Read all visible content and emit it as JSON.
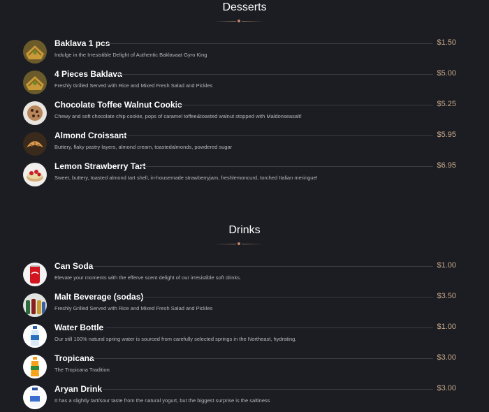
{
  "desserts": {
    "title": "Desserts",
    "items": [
      {
        "name": "Baklava 1 pcs",
        "description": "Indulge in the Irresistible Delight of Authentic Baklavaat Gyro King",
        "price": "$1.50",
        "icon": "baklava-icon"
      },
      {
        "name": "4 Pieces Baklava",
        "description": "Freshly Grilled Served with Rice and Mixed Fresh Salad and Pickles",
        "price": "$5.00",
        "icon": "baklava-icon"
      },
      {
        "name": "Chocolate Toffee Walnut Cookie",
        "description": "Chewy and soft chocolate chip cookie, pops of caramel toffee&toasted walnut stopped with Maldonseasalt!",
        "price": "$5.25",
        "icon": "cookie-icon"
      },
      {
        "name": "Almond Croissant",
        "description": "Buttery, flaky pastry layers, almond cream, toastedalmonds, powdered sugar",
        "price": "$5.95",
        "icon": "croissant-icon"
      },
      {
        "name": "Lemon Strawberry Tart",
        "description": "Sweet, buttery, toasted almond tart shell, in-housemade strawberryjam, freshlemoncurd, torched Italian meringue!",
        "price": "$6.95",
        "icon": "tart-icon"
      }
    ]
  },
  "drinks": {
    "title": "Drinks",
    "items": [
      {
        "name": "Can Soda",
        "description": "Elevate your moments with the efferve scent delight of our irresistible soft drinks.",
        "price": "$1.00",
        "icon": "soda-can-icon"
      },
      {
        "name": "Malt Beverage (sodas)",
        "description": "Freshly Grilled Served with Rice and Mixed Fresh Salad and Pickles",
        "price": "$3.50",
        "icon": "malt-bottles-icon"
      },
      {
        "name": "Water Bottle",
        "description": "Our still 100% natural spring water is sourced from carefully selected springs in the Northeast, hydrating.",
        "price": "$1.00",
        "icon": "water-bottle-icon"
      },
      {
        "name": "Tropicana",
        "description": "The Tropicana Tradition",
        "price": "$3.00",
        "icon": "juice-bottle-icon"
      },
      {
        "name": "Aryan Drink",
        "description": "It has a slightly tart/sour taste from the natural yogurt, but the biggest surprise is the saltiness",
        "price": "$3.00",
        "icon": "yogurt-drink-icon"
      }
    ]
  },
  "colors": {
    "background": "#1b1d22",
    "price": "#c9a98c",
    "accent": "#c8846a"
  }
}
